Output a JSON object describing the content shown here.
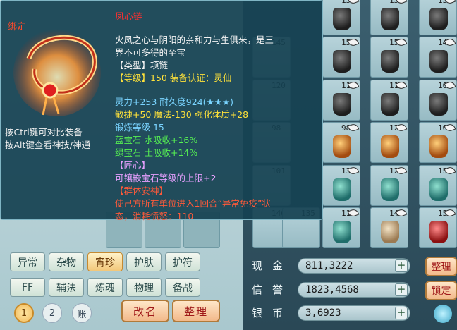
{
  "tooltip": {
    "bind_tag": "绑定",
    "item_name": "凤心链",
    "desc_line1": "火凤之心与阴阳的亲和力与生俱来，是三",
    "desc_line2": "界不可多得的至宝",
    "type_line": "【类型】项链",
    "level_line": "【等级】150 装备认证：灵仙",
    "stat_line1": "灵力+253 耐久度924(★★★)",
    "stat_line2": "敏捷+50 魔法-130 强化体质+28",
    "forge_line": "锻炼等级 15",
    "gem_line1": "蓝宝石 水吸收+16%",
    "gem_line2": "绿宝石 土吸收+14%",
    "craft_title": "【匠心】",
    "craft_line": "可镶嵌宝石等级的上限+2",
    "skill_title": "【群体安神】",
    "skill_line1": "使己方所有单位进入1回合“异常免疫”状",
    "skill_line2": "态，消耗愤怒：110",
    "hint_line1": "按Ctrl键可对比装备",
    "hint_line2": "按Alt键查看神技/神通"
  },
  "tabs_row1": [
    {
      "label": "异常",
      "active": false
    },
    {
      "label": "杂物",
      "active": false
    },
    {
      "label": "宵珍",
      "active": true
    },
    {
      "label": "护肤",
      "active": false
    },
    {
      "label": "护符",
      "active": false
    }
  ],
  "tabs_row2": [
    {
      "label": "FF"
    },
    {
      "label": "辅法"
    },
    {
      "label": "炼魂"
    },
    {
      "label": "物理"
    },
    {
      "label": "备战"
    }
  ],
  "pages": {
    "p1": "1",
    "p2": "2",
    "acct": "账"
  },
  "buttons": {
    "rename": "改名",
    "sort_left": "整理",
    "sort_right": "整理",
    "lock": "锁定"
  },
  "currency": {
    "cash_label": "现金",
    "cash_value": "811,3222",
    "rep_label": "信誉",
    "rep_value": "1823,4568",
    "silver_label": "银币",
    "silver_value": "3,6923"
  },
  "grid_slots": [
    {
      "num": "156",
      "icon": "jar"
    },
    {
      "num": "152",
      "icon": "jar"
    },
    {
      "num": "152",
      "icon": "jar"
    },
    {
      "num": "152",
      "icon": "jar"
    },
    {
      "num": "151",
      "icon": "jar"
    },
    {
      "num": "143",
      "icon": "jar"
    },
    {
      "num": "117",
      "icon": "jar"
    },
    {
      "num": "116",
      "icon": "jar"
    },
    {
      "num": "106",
      "icon": "jar"
    },
    {
      "num": "98",
      "icon": "orange-jar"
    },
    {
      "num": "124",
      "icon": "orange-jar"
    },
    {
      "num": "108",
      "icon": "orange-jar"
    },
    {
      "num": "132",
      "icon": "green-jar"
    },
    {
      "num": "123",
      "icon": "green-jar"
    },
    {
      "num": "155",
      "icon": "green-jar"
    },
    {
      "num": "115",
      "icon": "green-jar"
    },
    {
      "num": "142",
      "icon": "tan-jar"
    },
    {
      "num": "157",
      "icon": "red-jar"
    }
  ],
  "hidden_slots": [
    {
      "num": "145"
    },
    {
      "num": "120"
    },
    {
      "num": "98"
    },
    {
      "num": "101"
    },
    {
      "num": "146"
    },
    {
      "num": "135"
    }
  ]
}
